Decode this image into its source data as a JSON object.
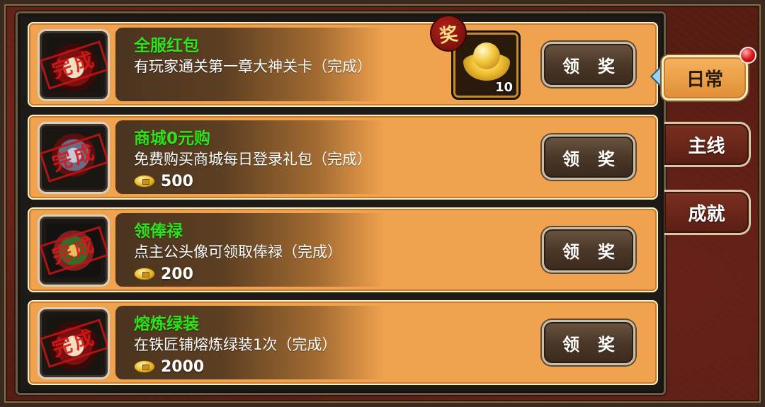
{
  "colors": {
    "title_green": "#2fe21a",
    "row_orange": "#f1a24e",
    "active_tab": "#f6b35c",
    "stamp_red": "#d71919"
  },
  "tabs": [
    {
      "label": "日常",
      "active": true,
      "notification": true
    },
    {
      "label": "主线",
      "active": false
    },
    {
      "label": "成就",
      "active": false
    }
  ],
  "tasks": [
    {
      "title": "全服红包",
      "description": "有玩家通关第一章大神关卡（完成）",
      "stamp": "完成",
      "reward_item": {
        "icon": "gold-ingot-icon",
        "quantity": "10",
        "badge": "奖"
      },
      "claim_label": "领奖"
    },
    {
      "title": "商城0元购",
      "description": "免费购买商城每日登录礼包（完成）",
      "stamp": "完成",
      "reward_coins": "500",
      "claim_label": "领奖"
    },
    {
      "title": "领俸禄",
      "description": "点主公头像可领取俸禄（完成）",
      "stamp": "完成",
      "reward_coins": "200",
      "claim_label": "领奖"
    },
    {
      "title": "熔炼绿装",
      "description": "在铁匠铺熔炼绿装1次（完成）",
      "stamp": "完成",
      "reward_coins": "2000",
      "claim_label": "领奖"
    }
  ]
}
